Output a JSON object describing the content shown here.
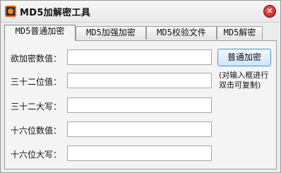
{
  "window": {
    "title": "MD5加解密工具",
    "close_symbol": "✕",
    "icons": {
      "app": "app-logo-icon",
      "close": "close-icon"
    }
  },
  "tabs": [
    {
      "label": "MD5普通加密",
      "active": true
    },
    {
      "label": "MD5加强加密",
      "active": false
    },
    {
      "label": "MD5校验文件",
      "active": false
    },
    {
      "label": "MD5解密",
      "active": false
    }
  ],
  "form": {
    "fields": [
      {
        "label": "欲加密数值：",
        "value": ""
      },
      {
        "label": "三十二位值：",
        "value": ""
      },
      {
        "label": "三十二大写：",
        "value": ""
      },
      {
        "label": "十六位数值：",
        "value": ""
      },
      {
        "label": "十六位大写：",
        "value": ""
      }
    ],
    "encrypt_button": "普通加密",
    "hint_line1": "(对输入框进行",
    "hint_line2": "双击可复制)"
  }
}
